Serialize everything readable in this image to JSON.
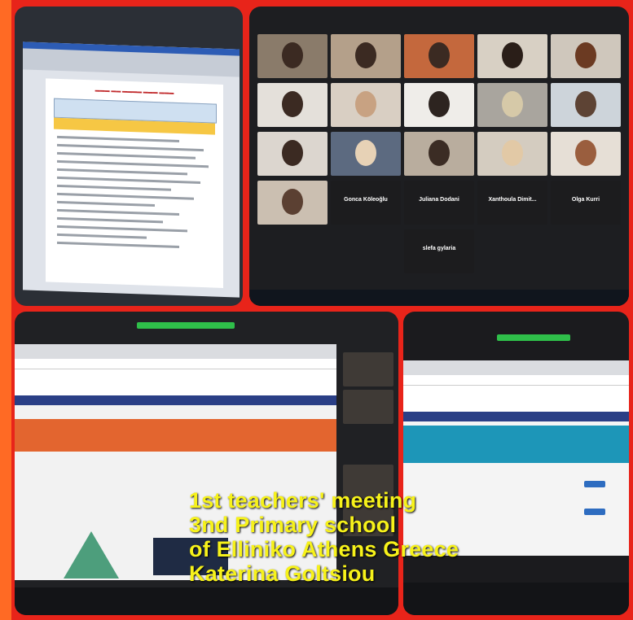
{
  "caption": {
    "line1": "1st teachers' meeting",
    "line2": "3nd Primary school",
    "line3": "of Elliniko Athens Greece",
    "line4": "Katerina Goltsiou"
  },
  "video_grid": {
    "name_tiles": [
      "Gonca Köleoğlu",
      "Juliana Dodani",
      "Xanthoula Dimit...",
      "Olga Kurri",
      "slefa gylaria"
    ]
  },
  "colors": {
    "caption": "#f7f21a",
    "frame": "#e8241a"
  }
}
